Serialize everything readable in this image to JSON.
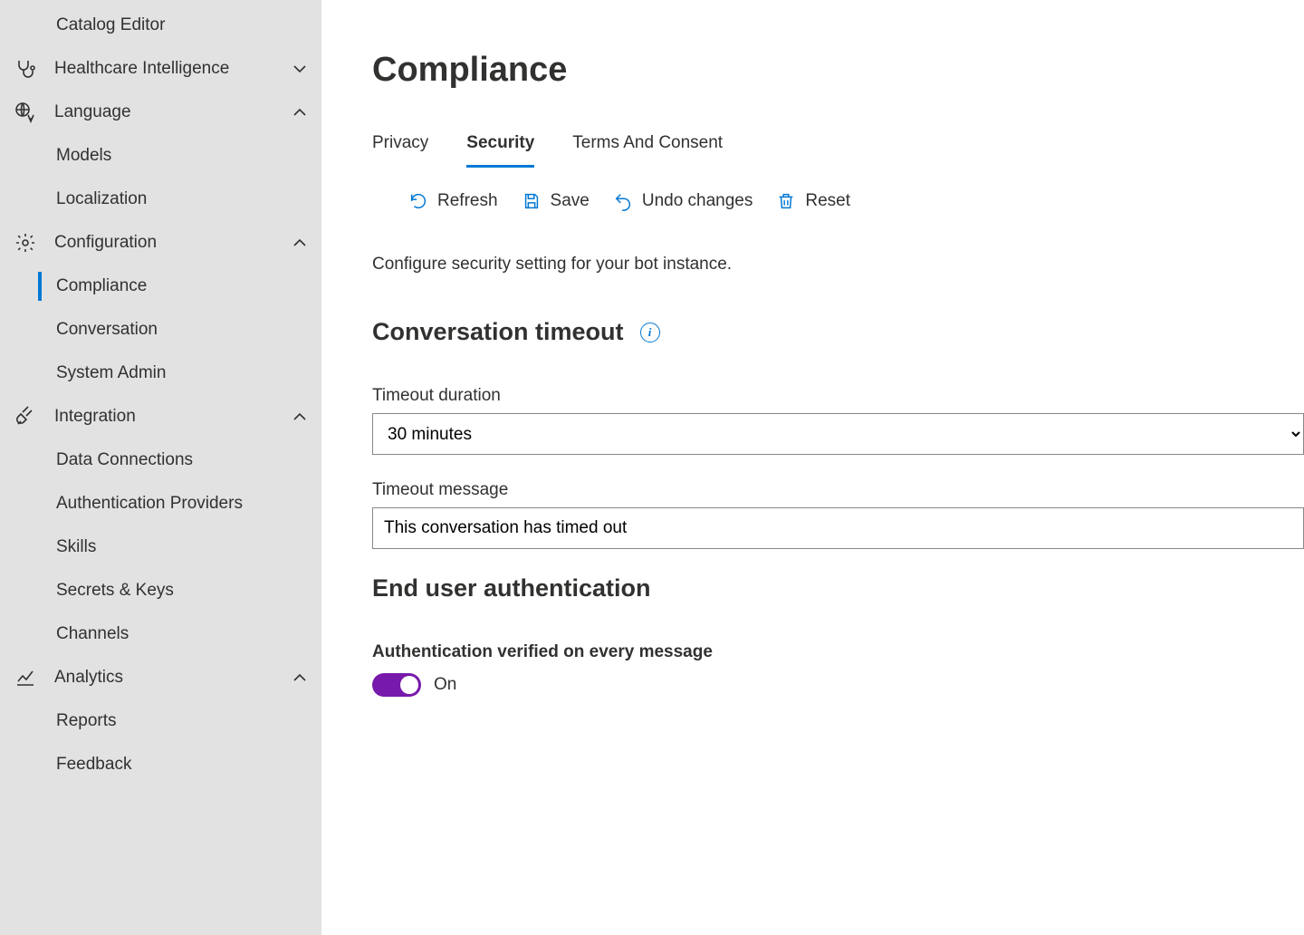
{
  "sidebar": {
    "items": [
      {
        "label": "Catalog Editor",
        "type": "item"
      },
      {
        "label": "Healthcare Intelligence",
        "type": "group",
        "icon": "stethoscope",
        "chev": "down"
      },
      {
        "label": "Language",
        "type": "group",
        "icon": "globe-lang",
        "chev": "up"
      },
      {
        "label": "Models",
        "type": "item"
      },
      {
        "label": "Localization",
        "type": "item"
      },
      {
        "label": "Configuration",
        "type": "group",
        "icon": "gear",
        "chev": "up"
      },
      {
        "label": "Compliance",
        "type": "item",
        "active": true
      },
      {
        "label": "Conversation",
        "type": "item"
      },
      {
        "label": "System Admin",
        "type": "item"
      },
      {
        "label": "Integration",
        "type": "group",
        "icon": "plug",
        "chev": "up"
      },
      {
        "label": "Data Connections",
        "type": "item"
      },
      {
        "label": "Authentication Providers",
        "type": "item"
      },
      {
        "label": "Skills",
        "type": "item"
      },
      {
        "label": "Secrets & Keys",
        "type": "item"
      },
      {
        "label": "Channels",
        "type": "item"
      },
      {
        "label": "Analytics",
        "type": "group",
        "icon": "chart",
        "chev": "up"
      },
      {
        "label": "Reports",
        "type": "item"
      },
      {
        "label": "Feedback",
        "type": "item"
      }
    ]
  },
  "page": {
    "title": "Compliance",
    "tabs": [
      {
        "label": "Privacy"
      },
      {
        "label": "Security",
        "active": true
      },
      {
        "label": "Terms And Consent"
      }
    ],
    "commands": {
      "refresh": "Refresh",
      "save": "Save",
      "undo": "Undo changes",
      "reset": "Reset"
    },
    "description": "Configure security setting for your bot instance.",
    "section_timeout": {
      "heading": "Conversation timeout",
      "duration_label": "Timeout duration",
      "duration_value": "30 minutes",
      "message_label": "Timeout message",
      "message_value": "This conversation has timed out"
    },
    "section_auth": {
      "heading": "End user authentication",
      "toggle_label": "Authentication verified on every message",
      "toggle_state": "On"
    }
  }
}
